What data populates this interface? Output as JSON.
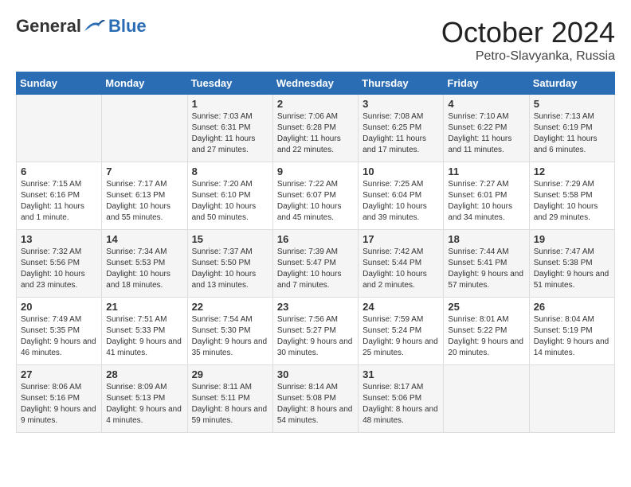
{
  "header": {
    "logo_general": "General",
    "logo_blue": "Blue",
    "month": "October 2024",
    "location": "Petro-Slavyanka, Russia"
  },
  "weekdays": [
    "Sunday",
    "Monday",
    "Tuesday",
    "Wednesday",
    "Thursday",
    "Friday",
    "Saturday"
  ],
  "weeks": [
    [
      {
        "day": "",
        "sunrise": "",
        "sunset": "",
        "daylight": ""
      },
      {
        "day": "",
        "sunrise": "",
        "sunset": "",
        "daylight": ""
      },
      {
        "day": "1",
        "sunrise": "Sunrise: 7:03 AM",
        "sunset": "Sunset: 6:31 PM",
        "daylight": "Daylight: 11 hours and 27 minutes."
      },
      {
        "day": "2",
        "sunrise": "Sunrise: 7:06 AM",
        "sunset": "Sunset: 6:28 PM",
        "daylight": "Daylight: 11 hours and 22 minutes."
      },
      {
        "day": "3",
        "sunrise": "Sunrise: 7:08 AM",
        "sunset": "Sunset: 6:25 PM",
        "daylight": "Daylight: 11 hours and 17 minutes."
      },
      {
        "day": "4",
        "sunrise": "Sunrise: 7:10 AM",
        "sunset": "Sunset: 6:22 PM",
        "daylight": "Daylight: 11 hours and 11 minutes."
      },
      {
        "day": "5",
        "sunrise": "Sunrise: 7:13 AM",
        "sunset": "Sunset: 6:19 PM",
        "daylight": "Daylight: 11 hours and 6 minutes."
      }
    ],
    [
      {
        "day": "6",
        "sunrise": "Sunrise: 7:15 AM",
        "sunset": "Sunset: 6:16 PM",
        "daylight": "Daylight: 11 hours and 1 minute."
      },
      {
        "day": "7",
        "sunrise": "Sunrise: 7:17 AM",
        "sunset": "Sunset: 6:13 PM",
        "daylight": "Daylight: 10 hours and 55 minutes."
      },
      {
        "day": "8",
        "sunrise": "Sunrise: 7:20 AM",
        "sunset": "Sunset: 6:10 PM",
        "daylight": "Daylight: 10 hours and 50 minutes."
      },
      {
        "day": "9",
        "sunrise": "Sunrise: 7:22 AM",
        "sunset": "Sunset: 6:07 PM",
        "daylight": "Daylight: 10 hours and 45 minutes."
      },
      {
        "day": "10",
        "sunrise": "Sunrise: 7:25 AM",
        "sunset": "Sunset: 6:04 PM",
        "daylight": "Daylight: 10 hours and 39 minutes."
      },
      {
        "day": "11",
        "sunrise": "Sunrise: 7:27 AM",
        "sunset": "Sunset: 6:01 PM",
        "daylight": "Daylight: 10 hours and 34 minutes."
      },
      {
        "day": "12",
        "sunrise": "Sunrise: 7:29 AM",
        "sunset": "Sunset: 5:58 PM",
        "daylight": "Daylight: 10 hours and 29 minutes."
      }
    ],
    [
      {
        "day": "13",
        "sunrise": "Sunrise: 7:32 AM",
        "sunset": "Sunset: 5:56 PM",
        "daylight": "Daylight: 10 hours and 23 minutes."
      },
      {
        "day": "14",
        "sunrise": "Sunrise: 7:34 AM",
        "sunset": "Sunset: 5:53 PM",
        "daylight": "Daylight: 10 hours and 18 minutes."
      },
      {
        "day": "15",
        "sunrise": "Sunrise: 7:37 AM",
        "sunset": "Sunset: 5:50 PM",
        "daylight": "Daylight: 10 hours and 13 minutes."
      },
      {
        "day": "16",
        "sunrise": "Sunrise: 7:39 AM",
        "sunset": "Sunset: 5:47 PM",
        "daylight": "Daylight: 10 hours and 7 minutes."
      },
      {
        "day": "17",
        "sunrise": "Sunrise: 7:42 AM",
        "sunset": "Sunset: 5:44 PM",
        "daylight": "Daylight: 10 hours and 2 minutes."
      },
      {
        "day": "18",
        "sunrise": "Sunrise: 7:44 AM",
        "sunset": "Sunset: 5:41 PM",
        "daylight": "Daylight: 9 hours and 57 minutes."
      },
      {
        "day": "19",
        "sunrise": "Sunrise: 7:47 AM",
        "sunset": "Sunset: 5:38 PM",
        "daylight": "Daylight: 9 hours and 51 minutes."
      }
    ],
    [
      {
        "day": "20",
        "sunrise": "Sunrise: 7:49 AM",
        "sunset": "Sunset: 5:35 PM",
        "daylight": "Daylight: 9 hours and 46 minutes."
      },
      {
        "day": "21",
        "sunrise": "Sunrise: 7:51 AM",
        "sunset": "Sunset: 5:33 PM",
        "daylight": "Daylight: 9 hours and 41 minutes."
      },
      {
        "day": "22",
        "sunrise": "Sunrise: 7:54 AM",
        "sunset": "Sunset: 5:30 PM",
        "daylight": "Daylight: 9 hours and 35 minutes."
      },
      {
        "day": "23",
        "sunrise": "Sunrise: 7:56 AM",
        "sunset": "Sunset: 5:27 PM",
        "daylight": "Daylight: 9 hours and 30 minutes."
      },
      {
        "day": "24",
        "sunrise": "Sunrise: 7:59 AM",
        "sunset": "Sunset: 5:24 PM",
        "daylight": "Daylight: 9 hours and 25 minutes."
      },
      {
        "day": "25",
        "sunrise": "Sunrise: 8:01 AM",
        "sunset": "Sunset: 5:22 PM",
        "daylight": "Daylight: 9 hours and 20 minutes."
      },
      {
        "day": "26",
        "sunrise": "Sunrise: 8:04 AM",
        "sunset": "Sunset: 5:19 PM",
        "daylight": "Daylight: 9 hours and 14 minutes."
      }
    ],
    [
      {
        "day": "27",
        "sunrise": "Sunrise: 8:06 AM",
        "sunset": "Sunset: 5:16 PM",
        "daylight": "Daylight: 9 hours and 9 minutes."
      },
      {
        "day": "28",
        "sunrise": "Sunrise: 8:09 AM",
        "sunset": "Sunset: 5:13 PM",
        "daylight": "Daylight: 9 hours and 4 minutes."
      },
      {
        "day": "29",
        "sunrise": "Sunrise: 8:11 AM",
        "sunset": "Sunset: 5:11 PM",
        "daylight": "Daylight: 8 hours and 59 minutes."
      },
      {
        "day": "30",
        "sunrise": "Sunrise: 8:14 AM",
        "sunset": "Sunset: 5:08 PM",
        "daylight": "Daylight: 8 hours and 54 minutes."
      },
      {
        "day": "31",
        "sunrise": "Sunrise: 8:17 AM",
        "sunset": "Sunset: 5:06 PM",
        "daylight": "Daylight: 8 hours and 48 minutes."
      },
      {
        "day": "",
        "sunrise": "",
        "sunset": "",
        "daylight": ""
      },
      {
        "day": "",
        "sunrise": "",
        "sunset": "",
        "daylight": ""
      }
    ]
  ]
}
